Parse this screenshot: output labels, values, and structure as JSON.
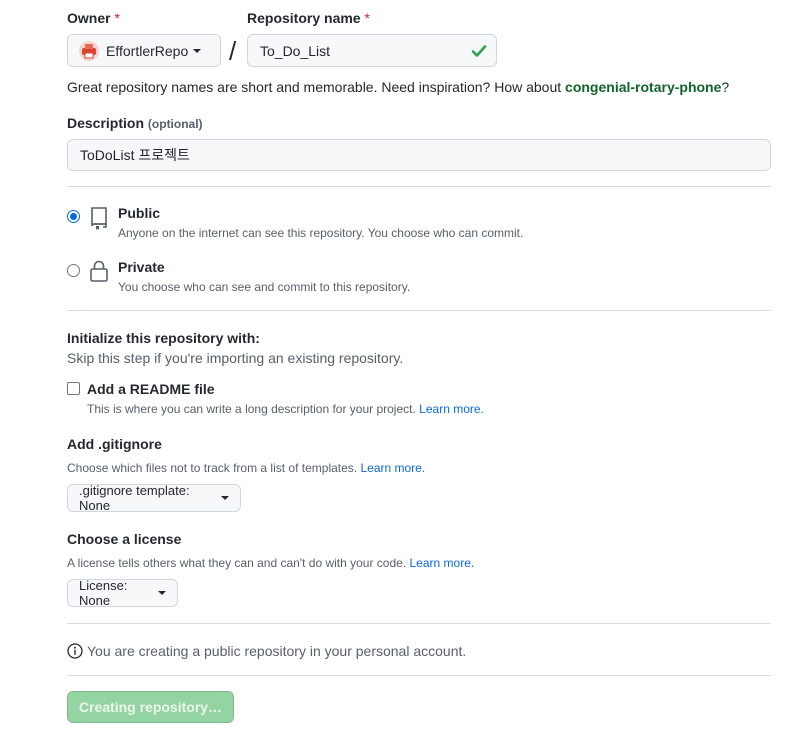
{
  "owner": {
    "label": "Owner",
    "required_mark": "*",
    "value": "EffortlerRepo"
  },
  "repository_name": {
    "label": "Repository name",
    "required_mark": "*",
    "value": "To_Do_List",
    "separator": "/"
  },
  "suggestion": {
    "prefix": "Great repository names are short and memorable. Need inspiration? How about ",
    "name": "congenial-rotary-phone",
    "suffix": "?"
  },
  "description": {
    "label": "Description",
    "optional": "(optional)",
    "value": "ToDoList 프로젝트"
  },
  "visibility": {
    "public": {
      "title": "Public",
      "desc": "Anyone on the internet can see this repository. You choose who can commit.",
      "selected": true
    },
    "private": {
      "title": "Private",
      "desc": "You choose who can see and commit to this repository.",
      "selected": false
    }
  },
  "init": {
    "heading": "Initialize this repository with:",
    "subheading": "Skip this step if you're importing an existing repository.",
    "readme": {
      "label": "Add a README file",
      "desc": "This is where you can write a long description for your project.",
      "link": "Learn more.",
      "checked": false
    }
  },
  "gitignore": {
    "heading": "Add .gitignore",
    "desc": "Choose which files not to track from a list of templates.",
    "link": "Learn more.",
    "button": ".gitignore template: None"
  },
  "license": {
    "heading": "Choose a license",
    "desc": "A license tells others what they can and can't do with your code.",
    "link": "Learn more.",
    "button": "License: None"
  },
  "info": {
    "text": "You are creating a public repository in your personal account."
  },
  "submit": {
    "label": "Creating repository…"
  },
  "colors": {
    "accent": "#0969da",
    "success": "#2da44e",
    "required": "#cf222e",
    "suggestion": "#116329",
    "submit_disabled": "#94d3a2"
  }
}
